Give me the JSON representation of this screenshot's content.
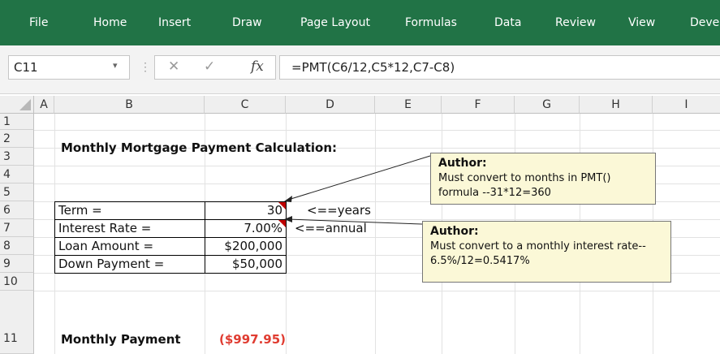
{
  "ribbon": {
    "tabs": [
      {
        "label": "File"
      },
      {
        "label": "Home"
      },
      {
        "label": "Insert"
      },
      {
        "label": "Draw"
      },
      {
        "label": "Page Layout"
      },
      {
        "label": "Formulas"
      },
      {
        "label": "Data"
      },
      {
        "label": "Review"
      },
      {
        "label": "View"
      },
      {
        "label": "Deve"
      }
    ]
  },
  "formula_bar": {
    "name_box": "C11",
    "cancel_glyph": "✕",
    "enter_glyph": "✓",
    "fx_glyph": "fx",
    "formula": "=PMT(C6/12,C5*12,C7-C8)"
  },
  "columns": [
    "A",
    "B",
    "C",
    "D",
    "E",
    "F",
    "G",
    "H",
    "I"
  ],
  "rows": [
    "1",
    "2",
    "3",
    "4",
    "5",
    "6",
    "7",
    "8",
    "9",
    "10",
    "11"
  ],
  "sheet": {
    "title": "Monthly Mortgage Payment Calculation:",
    "inputs": [
      {
        "label": "Term =",
        "value": "30",
        "note": "<==years"
      },
      {
        "label": "Interest Rate =",
        "value": "7.00%",
        "note": "<==annual"
      },
      {
        "label": "Loan Amount =",
        "value": "$200,000"
      },
      {
        "label": "Down Payment =",
        "value": "$50,000"
      }
    ],
    "result_label": "Monthly Payment",
    "result_value": "($997.95)"
  },
  "comments": [
    {
      "author": "Author:",
      "lines": [
        "Must convert to months in PMT()",
        "formula --31*12=360"
      ]
    },
    {
      "author": "Author:",
      "lines": [
        "Must convert to a monthly interest rate--",
        "6.5%/12=0.5417%"
      ]
    }
  ],
  "colors": {
    "ribbon": "#217346",
    "negative": "#e03c31",
    "note_bg": "#fbf8d7",
    "comment_indicator": "#c00000"
  }
}
